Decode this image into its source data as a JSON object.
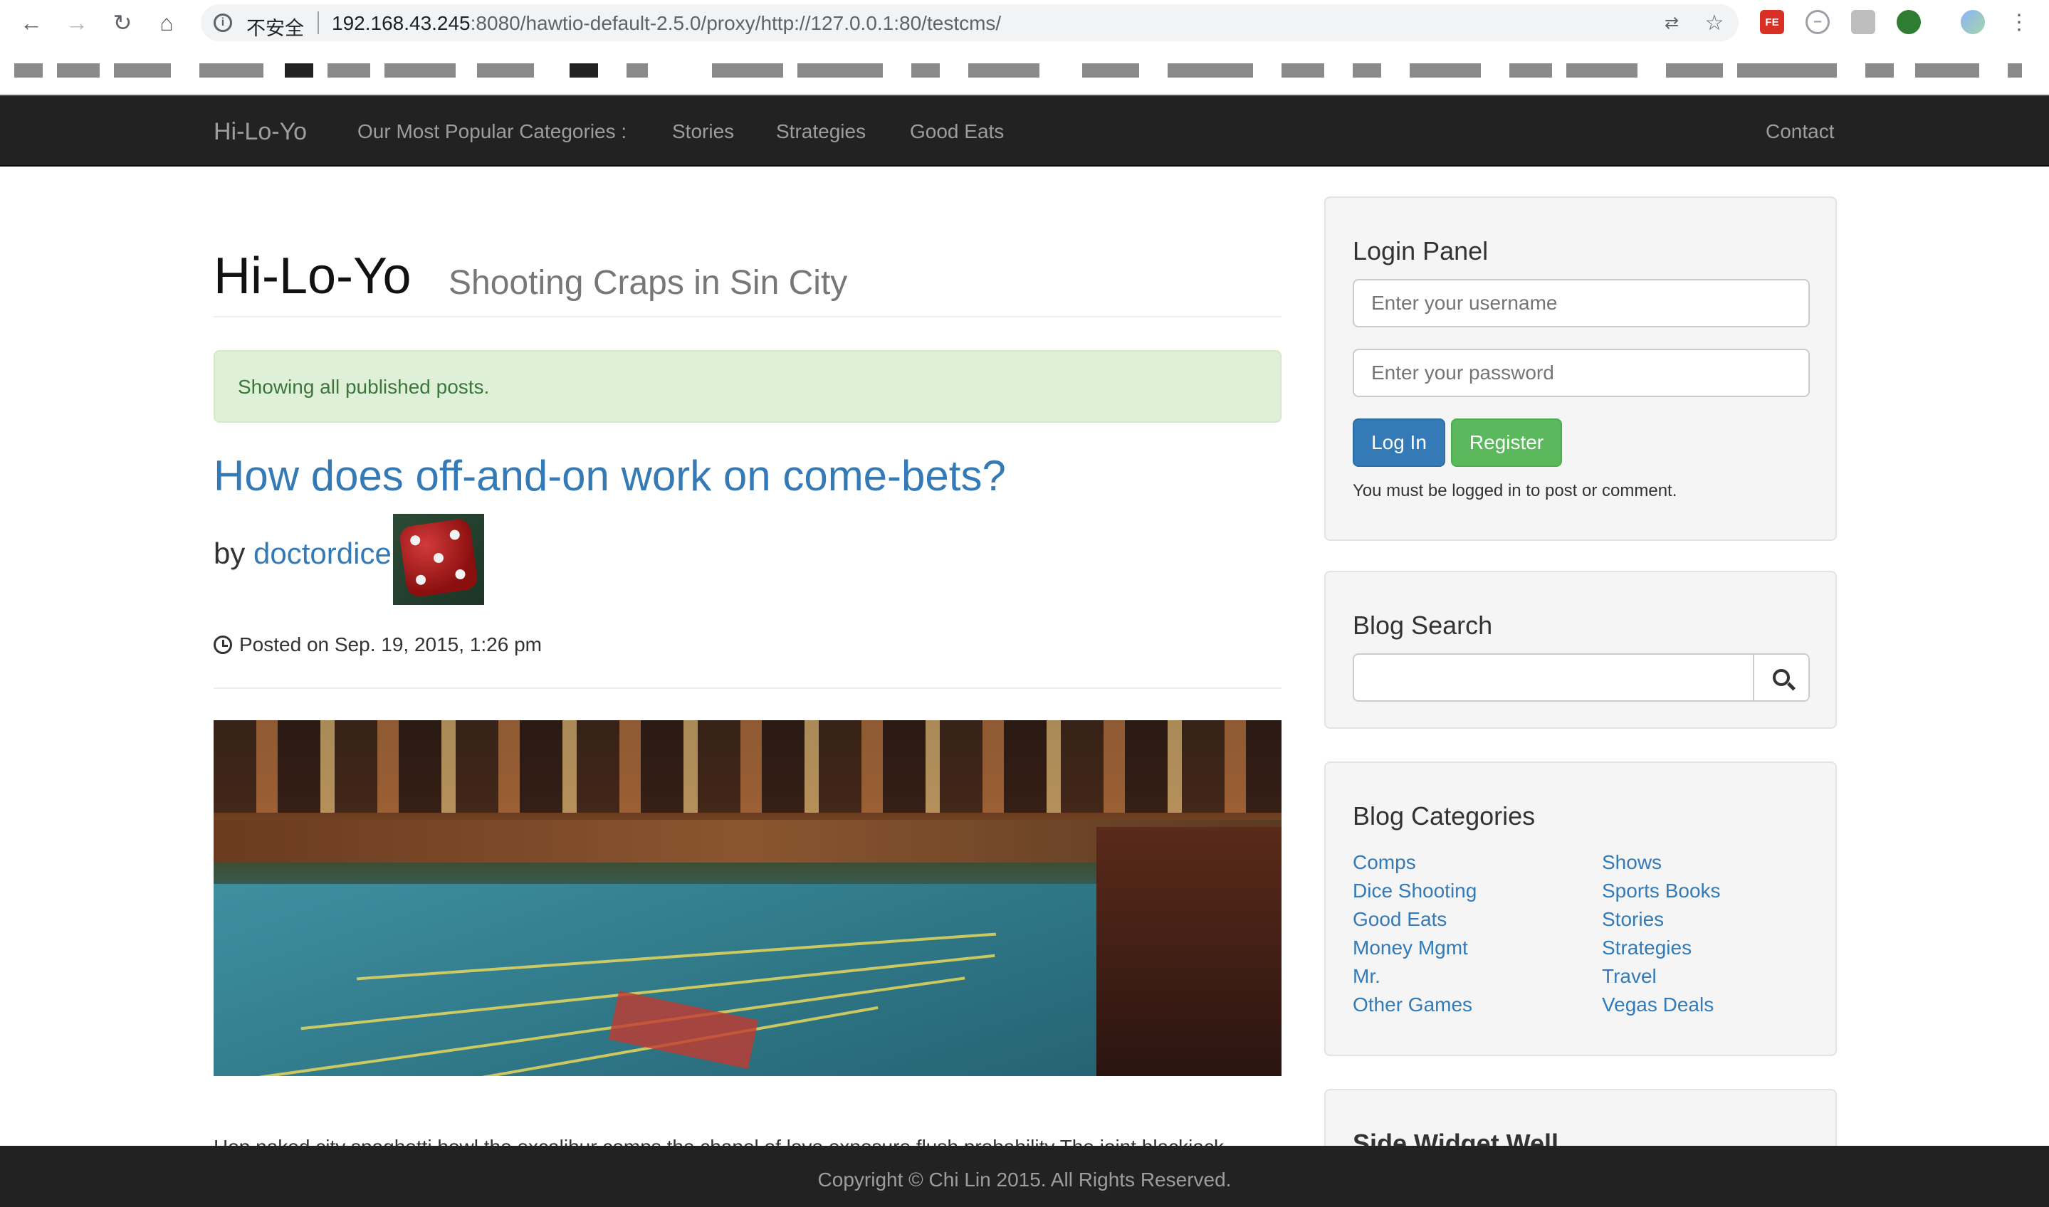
{
  "browser": {
    "security_label": "不安全",
    "url_host": "192.168.43.245",
    "url_rest": ":8080/hawtio-default-2.5.0/proxy/http://127.0.0.1:80/testcms/",
    "extension_fe_label": "FE"
  },
  "navbar": {
    "brand": "Hi-Lo-Yo",
    "items": [
      {
        "label": "Our Most Popular Categories :"
      },
      {
        "label": "Stories"
      },
      {
        "label": "Strategies"
      },
      {
        "label": "Good Eats"
      }
    ],
    "contact": "Contact"
  },
  "header": {
    "title": "Hi-Lo-Yo",
    "subtitle": "Shooting Craps in Sin City"
  },
  "alert": "Showing all published posts.",
  "post": {
    "title": "How does off-and-on work on come-bets?",
    "by": "by",
    "author": "doctordice",
    "posted": "Posted on Sep. 19, 2015, 1:26 pm",
    "excerpt": "Hop naked city spaghetti bowl the excalibur comps the chapel of love exposure flush probability The joint blackjack"
  },
  "login": {
    "heading": "Login Panel",
    "username_placeholder": "Enter your username",
    "password_placeholder": "Enter your password",
    "login_label": "Log In",
    "register_label": "Register",
    "note": "You must be logged in to post or comment."
  },
  "search": {
    "heading": "Blog Search",
    "value": ""
  },
  "categories": {
    "heading": "Blog Categories",
    "left": [
      "Comps",
      "Dice Shooting",
      "Good Eats",
      "Money Mgmt",
      "Mr.",
      "Other Games"
    ],
    "right": [
      "Shows",
      "Sports Books",
      "Stories",
      "Strategies",
      "Travel",
      "Vegas Deals"
    ]
  },
  "side_widget": {
    "heading": "Side Widget Well"
  },
  "footer": "Copyright © Chi Lin 2015. All Rights Reserved.",
  "colors": {
    "navbar": "#222222",
    "link": "#337ab7",
    "success": "#5cb85c",
    "alert_bg": "#dff0d8"
  }
}
